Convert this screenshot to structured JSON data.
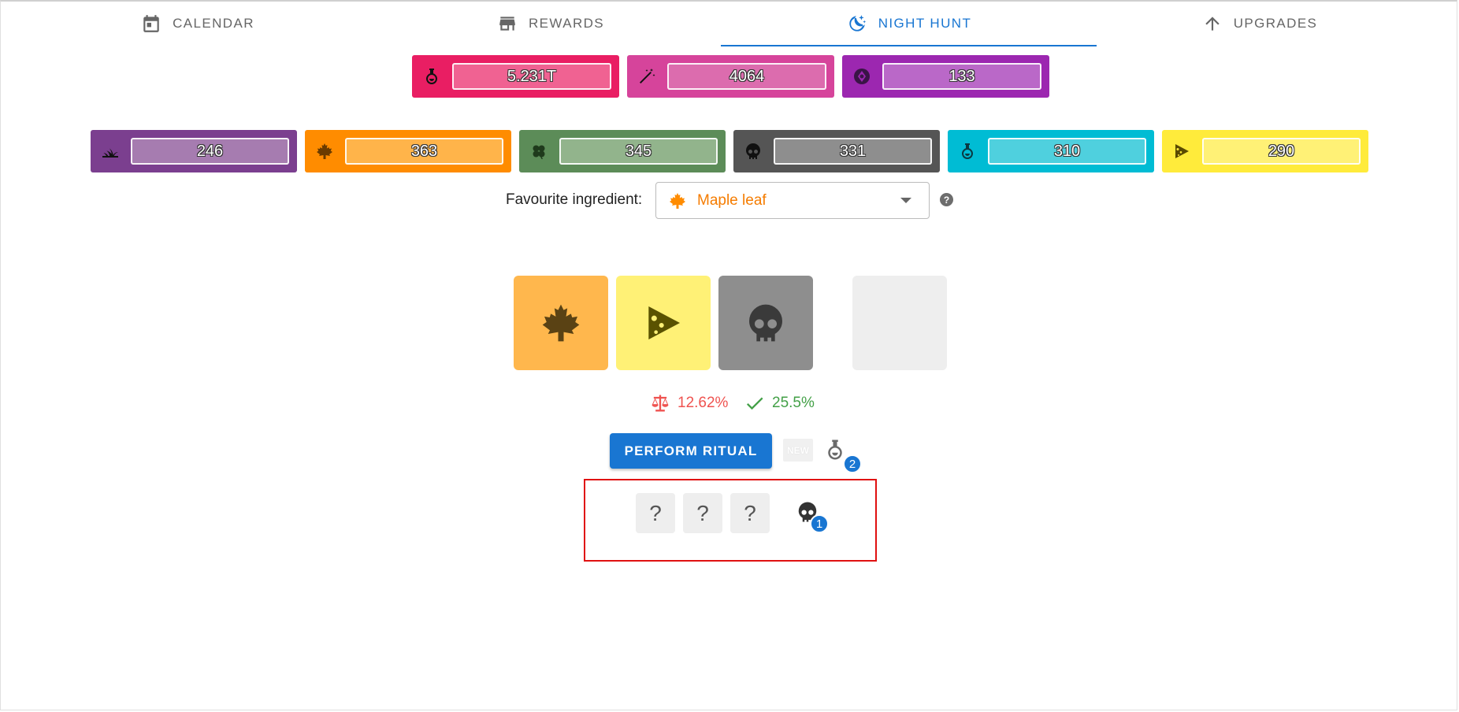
{
  "tabs": [
    {
      "label": "Calendar",
      "icon": "calendar-icon"
    },
    {
      "label": "Rewards",
      "icon": "store-icon"
    },
    {
      "label": "Night hunt",
      "icon": "moon-stars-icon"
    },
    {
      "label": "Upgrades",
      "icon": "arrow-up-icon"
    }
  ],
  "active_tab": "Night hunt",
  "currencies_top": [
    {
      "icon": "potion-icon",
      "value": "5.231T",
      "color": "#e91e63",
      "field": "#f06292"
    },
    {
      "icon": "magic-wand-icon",
      "value": "4064",
      "color": "#d6449b",
      "field": "#dc6cae"
    },
    {
      "icon": "gem-circle-icon",
      "value": "133",
      "color": "#9c27b0",
      "field": "#ba68c8"
    }
  ],
  "currencies_bottom": [
    {
      "icon": "grass-icon",
      "value": "246",
      "color": "#7b3f8f",
      "field": "#a67cb0"
    },
    {
      "icon": "maple-leaf-icon",
      "value": "363",
      "color": "#ff8c00",
      "field": "#ffb44a"
    },
    {
      "icon": "clover-icon",
      "value": "345",
      "color": "#5c8c58",
      "field": "#92b48c"
    },
    {
      "icon": "skull-icon",
      "value": "331",
      "color": "#555555",
      "field": "#8e8e8e"
    },
    {
      "icon": "flask-icon",
      "value": "310",
      "color": "#00bcd4",
      "field": "#4fd0de"
    },
    {
      "icon": "cheese-icon",
      "value": "290",
      "color": "#ffeb3b",
      "field": "#fff176"
    }
  ],
  "favourite": {
    "label": "Favourite ingredient:",
    "selected": "Maple leaf",
    "icon": "maple-leaf-icon"
  },
  "slots": [
    {
      "icon": "maple-leaf-icon",
      "color": "#ffb74d"
    },
    {
      "icon": "cheese-icon",
      "color": "#fff176"
    },
    {
      "icon": "skull-icon",
      "color": "#8e8e8e"
    },
    {
      "icon": "empty",
      "color": "#eeeeee"
    }
  ],
  "stats": {
    "balance_value": "12.62%",
    "success_value": "25.5%"
  },
  "actions": {
    "perform_label": "Perform ritual",
    "new_label": "NEW",
    "flask_count": "2"
  },
  "recipe": {
    "unknowns": [
      "?",
      "?",
      "?"
    ],
    "skull_count": "1"
  }
}
